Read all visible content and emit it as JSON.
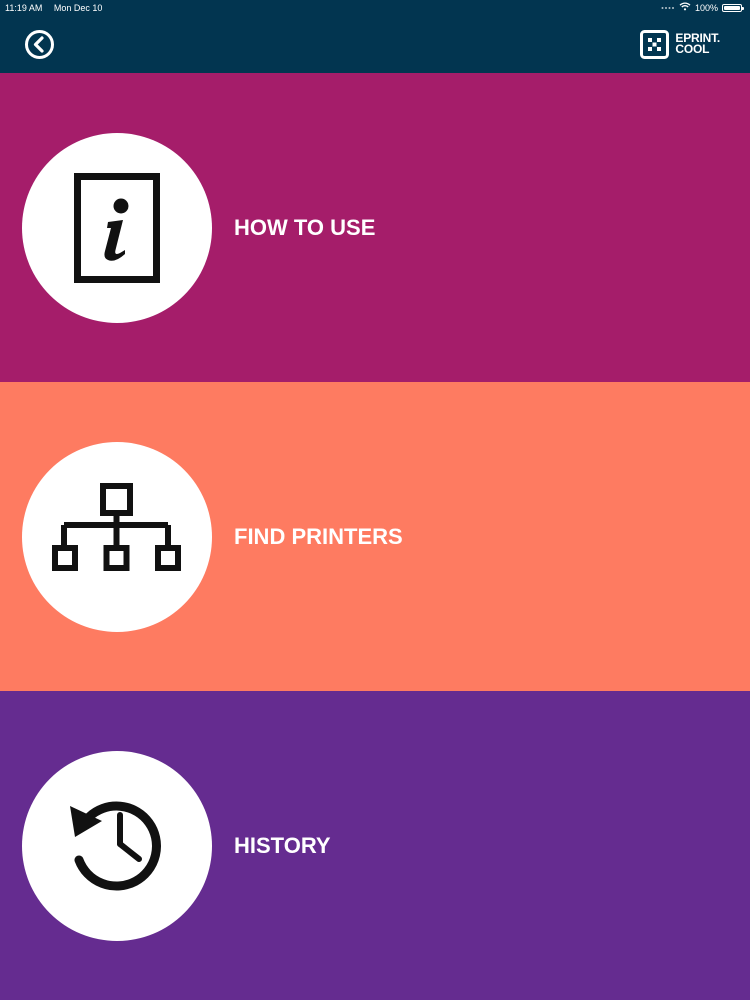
{
  "status_bar": {
    "time": "11:19 AM",
    "date": "Mon Dec 10",
    "battery": "100%",
    "battery_level": 1.0
  },
  "navbar": {
    "back_icon": "chevron-left-circle-icon",
    "logo_icon": "qr-square-icon",
    "logo_line1": "EPRINT.",
    "logo_line2": "COOL"
  },
  "menu": {
    "items": [
      {
        "label": "HOW TO USE",
        "icon": "info-document-icon",
        "color": "#A51D6A"
      },
      {
        "label": "FIND PRINTERS",
        "icon": "network-hierarchy-icon",
        "color": "#FE7B61"
      },
      {
        "label": "HISTORY",
        "icon": "history-clock-icon",
        "color": "#652C90"
      }
    ]
  },
  "colors": {
    "header": "#023550",
    "icon": "#111111",
    "text": "#FFFFFF"
  }
}
